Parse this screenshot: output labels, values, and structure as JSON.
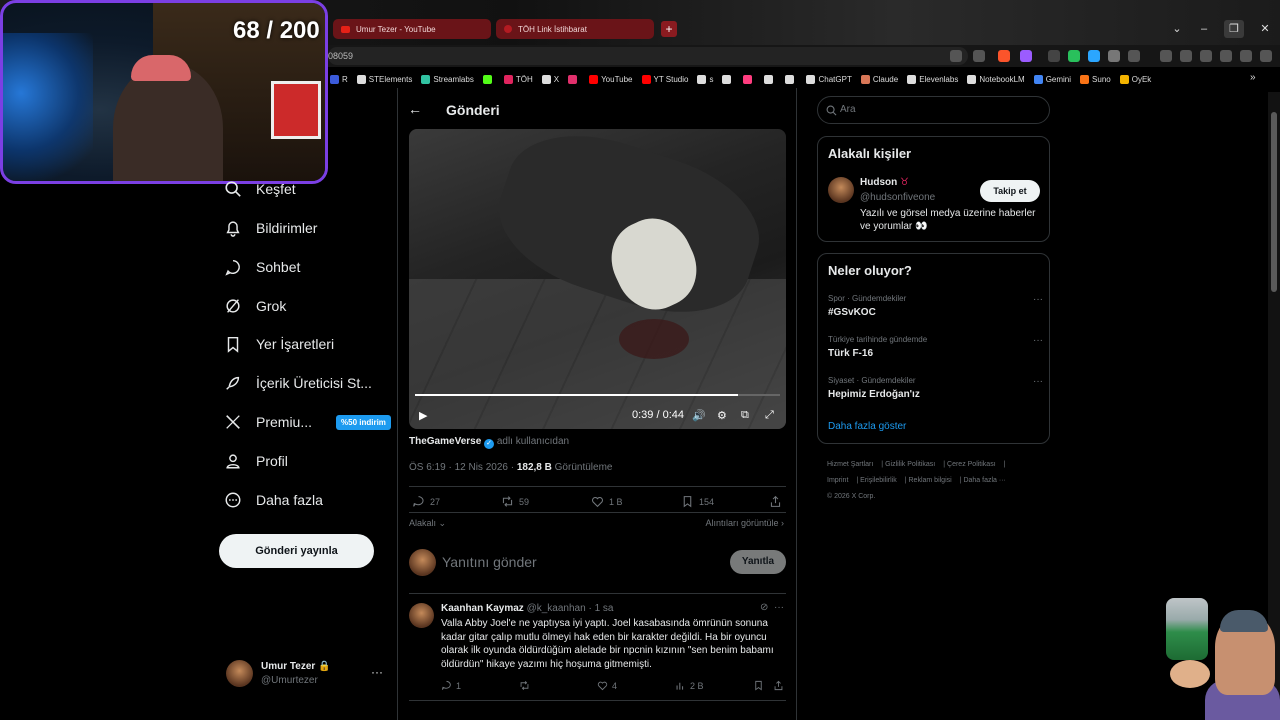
{
  "browser": {
    "tabs": [
      {
        "label": "Umur Tezer - YouTube"
      },
      {
        "label": "TÖH Link İstihbarat"
      }
    ],
    "new_tab": "+",
    "url_fragment": "08059",
    "bookmarks": [
      {
        "label": "R",
        "color": "#3b5bdb"
      },
      {
        "label": "STElements",
        "color": "#dddddd"
      },
      {
        "label": "Streamlabs",
        "color": "#31c3a2"
      },
      {
        "label": "",
        "color": "#53fc18"
      },
      {
        "label": "TÖH",
        "color": "#e0245e"
      },
      {
        "label": "X",
        "color": "#dddddd"
      },
      {
        "label": "",
        "color": "#e1306c"
      },
      {
        "label": "YouTube",
        "color": "#ff0000"
      },
      {
        "label": "YT Studio",
        "color": "#ff0000"
      },
      {
        "label": "s",
        "color": "#dddddd"
      },
      {
        "label": "",
        "color": "#dddddd"
      },
      {
        "label": "",
        "color": "#ff3d7f"
      },
      {
        "label": "",
        "color": "#dddddd"
      },
      {
        "label": "",
        "color": "#dddddd"
      },
      {
        "label": "ChatGPT",
        "color": "#dddddd"
      },
      {
        "label": "Claude",
        "color": "#d97757"
      },
      {
        "label": "Elevenlabs",
        "color": "#dddddd"
      },
      {
        "label": "NotebookLM",
        "color": "#dddddd"
      },
      {
        "label": "Gemini",
        "color": "#4285f4"
      },
      {
        "label": "Suno",
        "color": "#f97316"
      },
      {
        "label": "OyEk",
        "color": "#f4b400"
      }
    ],
    "overflow": "»"
  },
  "stream_overlay": {
    "counter": "68 / 200"
  },
  "nav": {
    "items": [
      {
        "label": "Keşfet",
        "icon": "search-icon"
      },
      {
        "label": "Bildirimler",
        "icon": "bell-icon"
      },
      {
        "label": "Sohbet",
        "icon": "chat-icon"
      },
      {
        "label": "Grok",
        "icon": "grok-icon"
      },
      {
        "label": "Yer İşaretleri",
        "icon": "bookmark-icon"
      },
      {
        "label": "İçerik Üreticisi St...",
        "icon": "rocket-icon"
      },
      {
        "label": "Premiu...",
        "icon": "x-logo-icon",
        "badge": "%50 indirim"
      },
      {
        "label": "Profil",
        "icon": "person-icon"
      },
      {
        "label": "Daha fazla",
        "icon": "more-circle-icon"
      }
    ],
    "post_button": "Gönderi yayınla",
    "account": {
      "name": "Umur Tezer",
      "handle": "@Umurtezer",
      "more": "···"
    }
  },
  "post": {
    "back": "←",
    "title": "Gönderi",
    "video": {
      "time": "0:39 / 0:44",
      "progress": 0.886
    },
    "author": "TheGameVerse",
    "author_note": "adlı kullanıcıdan",
    "timestamp": "ÖS 6:19 · 12 Nis 2026 · ",
    "views": "182,8 B",
    "views_label": " Görüntüleme",
    "stats": {
      "replies": "27",
      "reposts": "59",
      "likes": "1 B",
      "bookmarks": "154"
    },
    "sort": "Alakalı",
    "quotes": "Alıntıları görüntüle",
    "reply_placeholder": "Yanıtını gönder",
    "reply_button": "Yanıtla"
  },
  "comment": {
    "name": "Kaanhan Kaymaz",
    "handle": "@k_kaanhan · 1 sa",
    "text": "Valla Abby Joel'e ne yaptıysa iyi yaptı. Joel kasabasında ömrünün sonuna kadar gitar çalıp mutlu ölmeyi hak eden bir karakter değildi. Ha bir oyuncu olarak ilk oyunda öldürdüğüm alelade bir npcnin kızının \"sen benim babamı öldürdün\" hikaye yazımı hiç hoşuma gitmemişti.",
    "replies": "1",
    "likes": "4",
    "views": "2 B"
  },
  "sidebar": {
    "search_placeholder": "Ara",
    "who": {
      "title": "Alakalı kişiler",
      "name": "Hudson",
      "handle": "@hudsonfiveone",
      "bio": "Yazılı ve görsel medya üzerine haberler ve yorumlar 👀",
      "follow": "Takip et"
    },
    "trends": {
      "title": "Neler oluyor?",
      "items": [
        {
          "category": "Spor · Gündemdekiler",
          "topic": "#GSvKOC"
        },
        {
          "category": "Türkiye tarihinde gündemde",
          "topic": "Türk F-16"
        },
        {
          "category": "Siyaset · Gündemdekiler",
          "topic": "Hepimiz Erdoğan'ız"
        }
      ],
      "show_more": "Daha fazla göster"
    },
    "footer": [
      "Hizmet Şartları",
      "Gizlilik Politikası",
      "Çerez Politikası",
      "Imprint",
      "Erişilebilirlik",
      "Reklam bilgisi",
      "Daha fazla ···",
      "© 2026 X Corp."
    ]
  },
  "colors": {
    "accent": "#1d9bf0",
    "border": "#2f3336",
    "muted": "#71767b",
    "overlay_border": "#7b3fe4"
  }
}
